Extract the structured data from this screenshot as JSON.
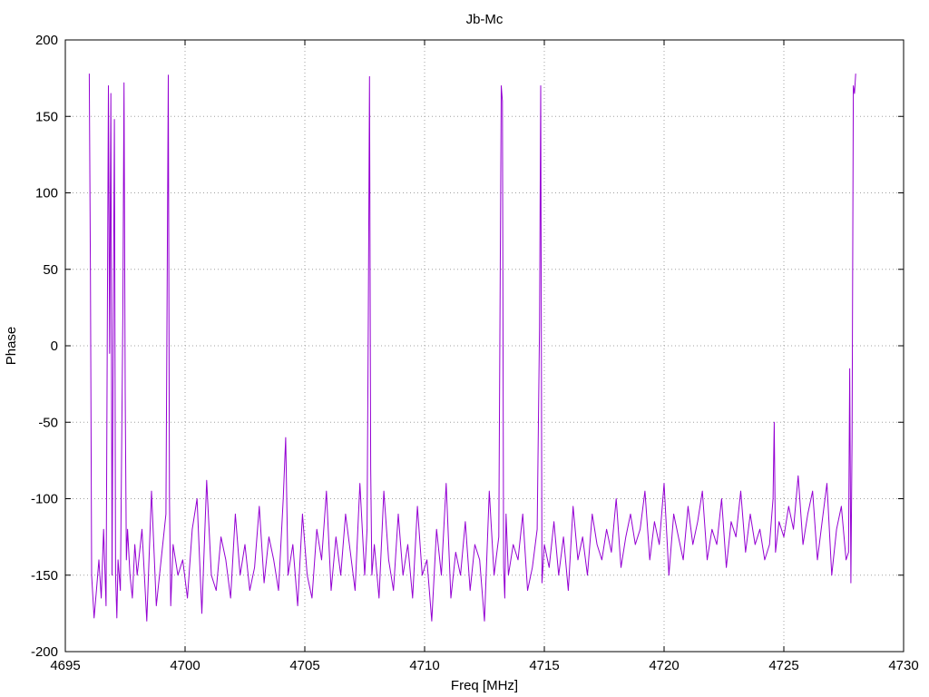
{
  "chart_data": {
    "type": "line",
    "title": "Jb-Mc",
    "xlabel": "Freq [MHz]",
    "ylabel": "Phase",
    "xlim": [
      4695,
      4730
    ],
    "ylim": [
      -200,
      200
    ],
    "x_ticks": [
      4695,
      4700,
      4705,
      4710,
      4715,
      4720,
      4725,
      4730
    ],
    "y_ticks": [
      -200,
      -150,
      -100,
      -50,
      0,
      50,
      100,
      150,
      200
    ],
    "grid": true,
    "legend": "none",
    "series": [
      {
        "color": "#9400d3",
        "x": [
          4696.0,
          4696.05,
          4696.1,
          4696.2,
          4696.3,
          4696.4,
          4696.5,
          4696.6,
          4696.7,
          4696.8,
          4696.85,
          4696.9,
          4696.95,
          4697.0,
          4697.05,
          4697.1,
          4697.15,
          4697.2,
          4697.3,
          4697.4,
          4697.45,
          4697.5,
          4697.55,
          4697.6,
          4697.7,
          4697.8,
          4697.9,
          4698.0,
          4698.2,
          4698.4,
          4698.6,
          4698.8,
          4699.0,
          4699.2,
          4699.3,
          4699.35,
          4699.4,
          4699.5,
          4699.7,
          4699.9,
          4700.1,
          4700.3,
          4700.5,
          4700.7,
          4700.9,
          4701.1,
          4701.3,
          4701.5,
          4701.7,
          4701.9,
          4702.1,
          4702.3,
          4702.5,
          4702.7,
          4702.9,
          4703.1,
          4703.3,
          4703.5,
          4703.7,
          4703.9,
          4704.1,
          4704.2,
          4704.3,
          4704.5,
          4704.7,
          4704.9,
          4705.1,
          4705.3,
          4705.5,
          4705.7,
          4705.9,
          4706.1,
          4706.3,
          4706.5,
          4706.7,
          4706.9,
          4707.1,
          4707.3,
          4707.5,
          4707.6,
          4707.65,
          4707.7,
          4707.75,
          4707.8,
          4707.9,
          4708.1,
          4708.3,
          4708.5,
          4708.7,
          4708.9,
          4709.1,
          4709.3,
          4709.5,
          4709.7,
          4709.9,
          4710.1,
          4710.3,
          4710.5,
          4710.7,
          4710.9,
          4711.1,
          4711.3,
          4711.5,
          4711.7,
          4711.9,
          4712.1,
          4712.3,
          4712.5,
          4712.7,
          4712.9,
          4713.1,
          4713.2,
          4713.25,
          4713.3,
          4713.35,
          4713.4,
          4713.5,
          4713.7,
          4713.9,
          4714.1,
          4714.3,
          4714.5,
          4714.7,
          4714.8,
          4714.85,
          4714.9,
          4715.0,
          4715.2,
          4715.4,
          4715.6,
          4715.8,
          4716.0,
          4716.2,
          4716.4,
          4716.6,
          4716.8,
          4717.0,
          4717.2,
          4717.4,
          4717.6,
          4717.8,
          4718.0,
          4718.2,
          4718.4,
          4718.6,
          4718.8,
          4719.0,
          4719.2,
          4719.4,
          4719.6,
          4719.8,
          4720.0,
          4720.2,
          4720.4,
          4720.6,
          4720.8,
          4721.0,
          4721.2,
          4721.4,
          4721.6,
          4721.8,
          4722.0,
          4722.2,
          4722.4,
          4722.6,
          4722.8,
          4723.0,
          4723.2,
          4723.4,
          4723.6,
          4723.8,
          4724.0,
          4724.2,
          4724.4,
          4724.55,
          4724.6,
          4724.65,
          4724.8,
          4725.0,
          4725.2,
          4725.4,
          4725.6,
          4725.8,
          4726.0,
          4726.2,
          4726.4,
          4726.6,
          4726.8,
          4727.0,
          4727.2,
          4727.4,
          4727.6,
          4727.7,
          4727.75,
          4727.8,
          4727.85,
          4727.9,
          4727.95,
          4728.0
        ],
        "y": [
          178,
          45,
          -150,
          -178,
          -160,
          -140,
          -165,
          -120,
          -170,
          170,
          -5,
          165,
          -150,
          10,
          148,
          -150,
          -178,
          -140,
          -160,
          20,
          172,
          -30,
          -140,
          -120,
          -150,
          -165,
          -130,
          -150,
          -120,
          -180,
          -95,
          -170,
          -140,
          -110,
          177,
          -100,
          -170,
          -130,
          -150,
          -140,
          -165,
          -120,
          -100,
          -175,
          -88,
          -150,
          -160,
          -125,
          -140,
          -165,
          -110,
          -150,
          -130,
          -160,
          -145,
          -105,
          -155,
          -125,
          -140,
          -160,
          -100,
          -60,
          -150,
          -130,
          -170,
          -110,
          -150,
          -165,
          -120,
          -140,
          -95,
          -160,
          -125,
          -150,
          -110,
          -135,
          -160,
          -90,
          -150,
          -120,
          20,
          176,
          -80,
          -150,
          -130,
          -165,
          -95,
          -140,
          -160,
          -110,
          -150,
          -130,
          -165,
          -105,
          -150,
          -140,
          -180,
          -120,
          -150,
          -90,
          -165,
          -135,
          -150,
          -115,
          -160,
          -130,
          -140,
          -180,
          -95,
          -150,
          -125,
          170,
          160,
          -145,
          -165,
          -110,
          -150,
          -130,
          -140,
          -110,
          -160,
          -145,
          -120,
          12,
          170,
          -155,
          -130,
          -145,
          -115,
          -150,
          -125,
          -160,
          -105,
          -140,
          -125,
          -150,
          -110,
          -130,
          -140,
          -120,
          -135,
          -100,
          -145,
          -125,
          -110,
          -130,
          -120,
          -95,
          -140,
          -115,
          -130,
          -90,
          -150,
          -110,
          -125,
          -140,
          -105,
          -130,
          -115,
          -95,
          -140,
          -120,
          -130,
          -100,
          -145,
          -115,
          -125,
          -95,
          -135,
          -110,
          -130,
          -120,
          -140,
          -130,
          -100,
          -50,
          -135,
          -115,
          -125,
          -105,
          -120,
          -85,
          -130,
          -110,
          -95,
          -140,
          -115,
          -90,
          -150,
          -120,
          -105,
          -140,
          -135,
          -15,
          -155,
          -60,
          170,
          165,
          178
        ]
      }
    ]
  }
}
